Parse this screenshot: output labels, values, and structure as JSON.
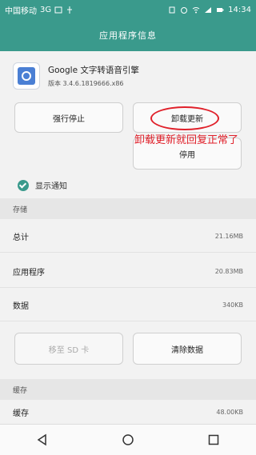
{
  "status": {
    "carrier": "中国移动",
    "network": "3G",
    "time": "14:34"
  },
  "title": "应用程序信息",
  "app": {
    "name": "Google 文字转语音引擎",
    "version": "版本 3.4.6.1819666.x86"
  },
  "buttons": {
    "force_stop": "强行停止",
    "uninstall_updates": "卸载更新",
    "disable": "停用",
    "move_sd": "移至 SD 卡",
    "clear_data": "清除数据"
  },
  "annotation": "卸载更新就回复正常了",
  "notify_label": "显示通知",
  "storage": {
    "header": "存储",
    "rows": [
      {
        "label": "总计",
        "value": "21.16MB"
      },
      {
        "label": "应用程序",
        "value": "20.83MB"
      },
      {
        "label": "数据",
        "value": "340KB"
      }
    ]
  },
  "cache": {
    "header": "缓存",
    "label": "缓存",
    "value": "48.00KB"
  },
  "accent_color": "#3a9a8c",
  "annotation_color": "#e0202a",
  "icons": [
    "sim-icon",
    "wifi-icon",
    "alarm-icon",
    "battery-icon",
    "back-icon",
    "home-icon",
    "recents-icon"
  ]
}
